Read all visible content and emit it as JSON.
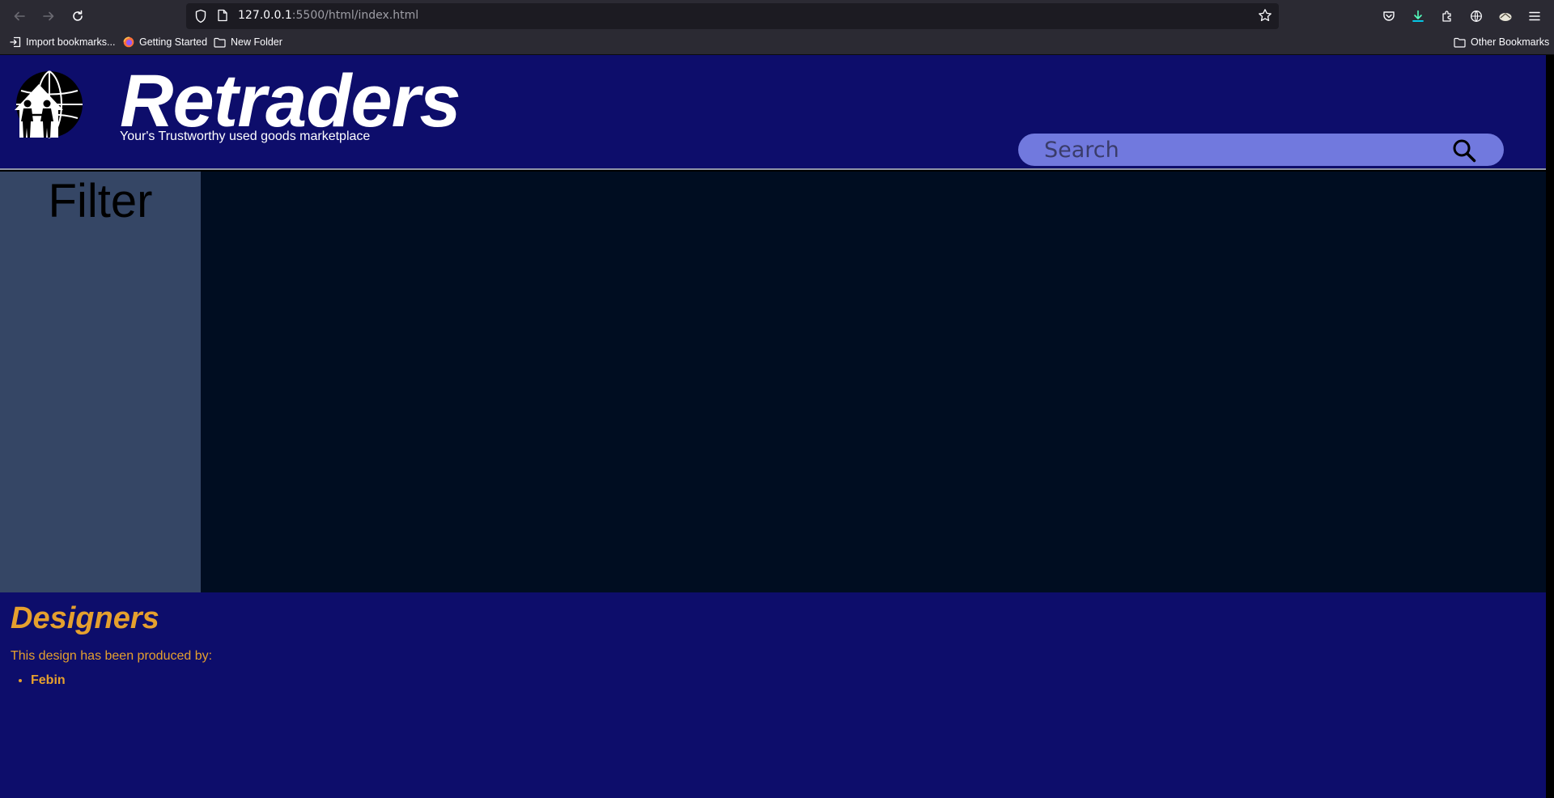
{
  "browser": {
    "url_host": "127.0.0.1",
    "url_rest": ":5500/html/index.html",
    "bookmarks": [
      {
        "label": "Import bookmarks...",
        "icon": "import-icon"
      },
      {
        "label": "Getting Started",
        "icon": "firefox-icon"
      },
      {
        "label": "New Folder",
        "icon": "folder-icon"
      }
    ],
    "other_bookmarks": "Other Bookmarks"
  },
  "header": {
    "brand": "Retraders",
    "tagline": "Your's Trustworthy used goods marketplace",
    "logo_icon": "globe-house-people-logo"
  },
  "search": {
    "placeholder": "Search",
    "icon": "magnifier-icon"
  },
  "filter": {
    "title": "Filter"
  },
  "footer": {
    "title": "Designers",
    "text": "This design has been produced by:",
    "designers": [
      "Febin"
    ]
  },
  "colors": {
    "header_bg": "#0d0d6b",
    "filter_bg": "#354665",
    "content_bg": "#000d21",
    "accent": "#e5a02e",
    "search_bg": "#7179de"
  }
}
